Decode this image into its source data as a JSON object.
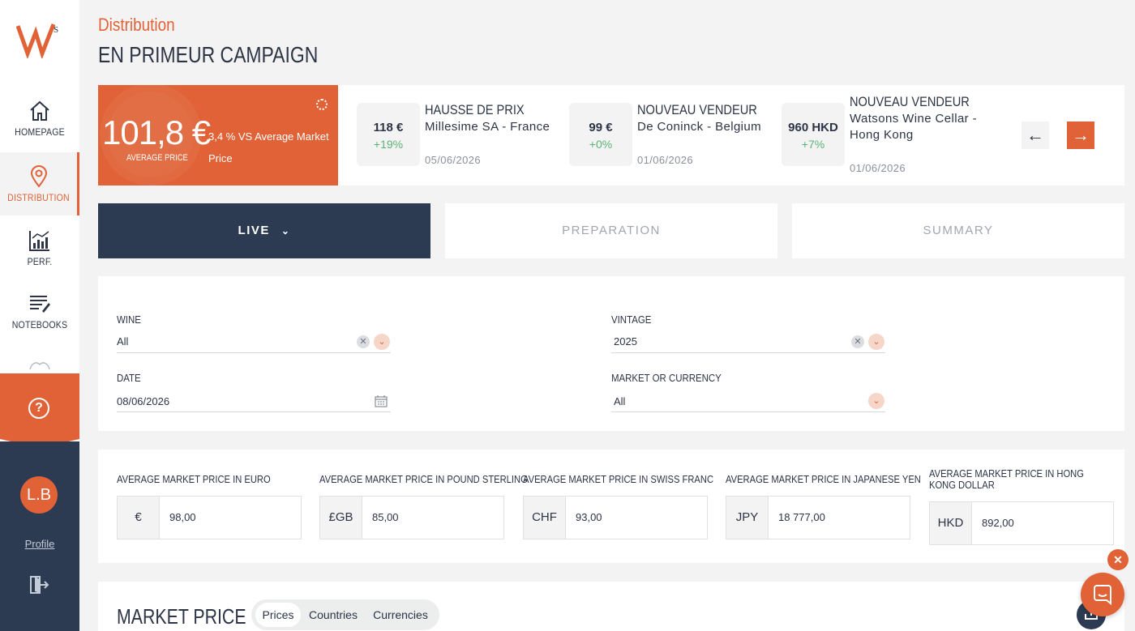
{
  "nav": {
    "items": [
      {
        "label": "HOMEPAGE",
        "icon": "home-icon"
      },
      {
        "label": "DISTRIBUTION",
        "icon": "map-pin-icon"
      },
      {
        "label": "PERF.",
        "icon": "chart-icon"
      },
      {
        "label": "NOTEBOOKS",
        "icon": "notebook-icon"
      }
    ],
    "avatar_initials": "L.B",
    "profile_label": "Profile"
  },
  "header": {
    "breadcrumb": "Distribution",
    "title": "EN PRIMEUR CAMPAIGN"
  },
  "banner": {
    "average_price": "101,8 €",
    "average_label": "AVERAGE PRICE",
    "vs_text": "3,4 % VS Average Market Price",
    "news": [
      {
        "value": "118 €",
        "change": "+19%",
        "title": "HAUSSE DE PRIX",
        "subtitle": "Millesime SA - France",
        "date": "05/06/2026"
      },
      {
        "value": "99 €",
        "change": "+0%",
        "title": "NOUVEAU VENDEUR",
        "subtitle": "De Coninck - Belgium",
        "date": "01/06/2026"
      },
      {
        "value": "960 HKD",
        "change": "+7%",
        "title": "NOUVEAU VENDEUR",
        "subtitle": "Watsons Wine Cellar - Hong Kong",
        "date": "01/06/2026"
      }
    ],
    "arrow_prev": "←",
    "arrow_next": "→"
  },
  "tabs": [
    {
      "label": "LIVE"
    },
    {
      "label": "PREPARATION"
    },
    {
      "label": "SUMMARY"
    }
  ],
  "filters": {
    "wine": {
      "label": "WINE",
      "value": "All"
    },
    "vintage": {
      "label": "VINTAGE",
      "value": "2025"
    },
    "date": {
      "label": "DATE",
      "value": "08/06/2026"
    },
    "market": {
      "label": "MARKET OR CURRENCY",
      "value": "All"
    }
  },
  "market_prices": [
    {
      "label": "AVERAGE MARKET PRICE IN EURO",
      "currency": "€",
      "value": "98,00"
    },
    {
      "label": "AVERAGE MARKET PRICE IN POUND STERLING",
      "currency": "£GB",
      "value": "85,00"
    },
    {
      "label": "AVERAGE MARKET PRICE IN SWISS FRANC",
      "currency": "CHF",
      "value": "93,00"
    },
    {
      "label": "AVERAGE MARKET PRICE IN JAPANESE YEN",
      "currency": "JPY",
      "value": "18 777,00"
    },
    {
      "label": "AVERAGE MARKET PRICE IN HONG KONG DOLLAR",
      "currency": "HKD",
      "value": "892,00"
    }
  ],
  "market_section": {
    "title": "MARKET PRICE",
    "segments": [
      "Prices",
      "Countries",
      "Currencies"
    ]
  },
  "colors": {
    "accent": "#e06236",
    "navy": "#2c3a52",
    "positive": "#5cb377"
  }
}
